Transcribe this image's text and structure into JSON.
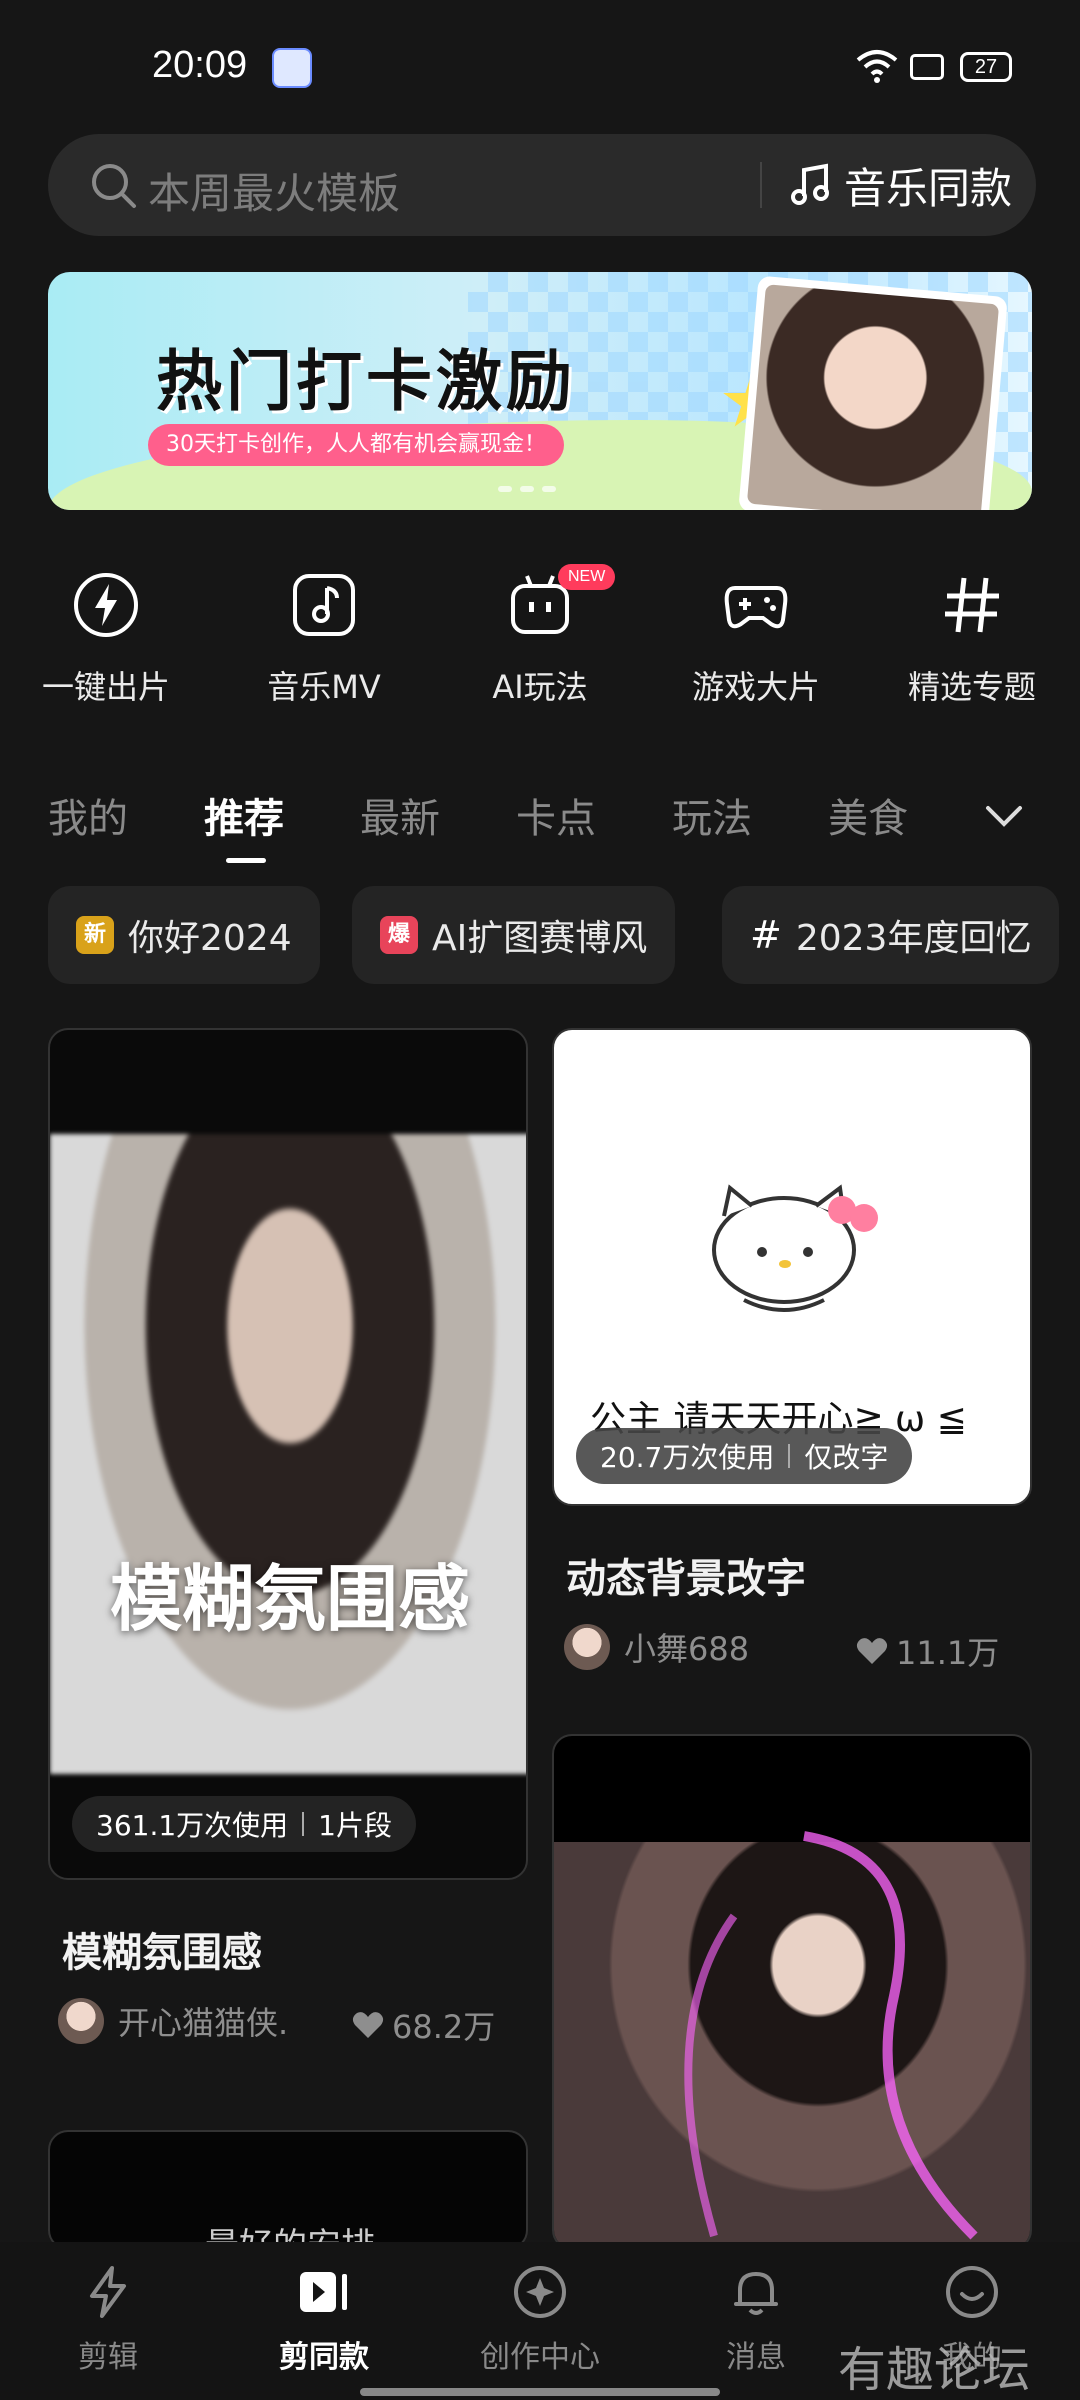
{
  "status_bar": {
    "time": "20:09",
    "battery": "27"
  },
  "search": {
    "placeholder": "本周最火模板",
    "music_label": "音乐同款"
  },
  "banner": {
    "title": "热门打卡激励",
    "subtitle": "30天打卡创作，人人都有机会赢现金！"
  },
  "shortcuts": [
    {
      "label": "一键出片",
      "icon": "lightning-icon"
    },
    {
      "label": "音乐MV",
      "icon": "music-note-icon"
    },
    {
      "label": "AI玩法",
      "icon": "robot-icon",
      "badge": "NEW"
    },
    {
      "label": "游戏大片",
      "icon": "gamepad-icon"
    },
    {
      "label": "精选专题",
      "icon": "hashtag-icon"
    }
  ],
  "tabs": [
    "我的",
    "推荐",
    "最新",
    "卡点",
    "玩法",
    "美食"
  ],
  "active_tab": "推荐",
  "chips": [
    {
      "badge": "新",
      "label": "你好2024",
      "badge_color": "#d9a21a"
    },
    {
      "badge": "爆",
      "label": "AI扩图赛博风",
      "badge_color": "#e8445a"
    },
    {
      "badge": "#",
      "label": "2023年度回忆"
    }
  ],
  "feed": {
    "left": {
      "overlay_text": "模糊氛围感",
      "usage": "361.1万次使用",
      "segments": "1片段",
      "title": "模糊氛围感",
      "author": "开心猫猫侠.",
      "likes": "68.2万"
    },
    "left_next": {
      "overlay_text": "最好的安排"
    },
    "right": {
      "overlay_text": "公主 请天天开心≧ ω ≦",
      "usage": "20.7万次使用",
      "tag": "仅改字",
      "title": "动态背景改字",
      "author": "小舞688",
      "likes": "11.1万"
    }
  },
  "nav": [
    {
      "label": "剪辑",
      "icon": "lightning-icon"
    },
    {
      "label": "剪同款",
      "icon": "template-play-icon"
    },
    {
      "label": "创作中心",
      "icon": "compass-icon"
    },
    {
      "label": "消息",
      "icon": "bell-icon"
    },
    {
      "label": "我的",
      "icon": "smile-icon"
    }
  ],
  "active_nav": "剪同款",
  "watermark": "有趣论坛",
  "colors": {
    "background": "#161616",
    "accent_pink": "#ff5f8c",
    "new_badge": "#ff3b5c"
  }
}
